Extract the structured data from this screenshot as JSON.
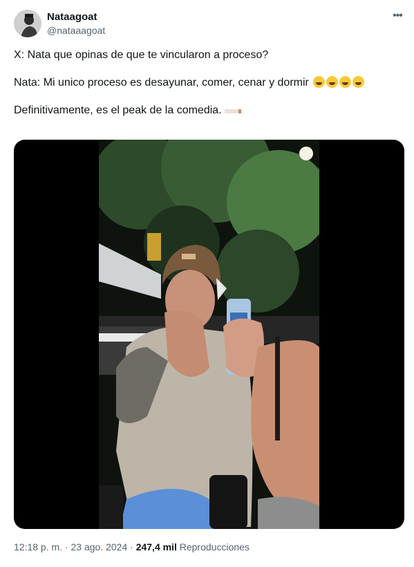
{
  "author": {
    "name": "Nataagoat",
    "handle": "@nataaagoat"
  },
  "tweet": {
    "line1": "X: Nata que opinas de que te vincularon a proceso?",
    "line2": "Nata: Mi unico proceso es desayunar, comer, cenar y dormir",
    "line3": "Definitivamente, es el peak de la comedia.",
    "emojis_line2": [
      "rolling-on-floor-laughing-emoji",
      "joy-emoji",
      "rolling-on-floor-laughing-emoji",
      "joy-emoji"
    ],
    "emoji_line3": "cigarette-emoji"
  },
  "meta": {
    "time": "12:18 p. m.",
    "separator": "·",
    "date": "23 ago. 2024",
    "views_count": "247,4 mil",
    "views_label": "Reproducciones"
  },
  "icons": {
    "more": "more-options-icon",
    "avatar": "avatar"
  }
}
